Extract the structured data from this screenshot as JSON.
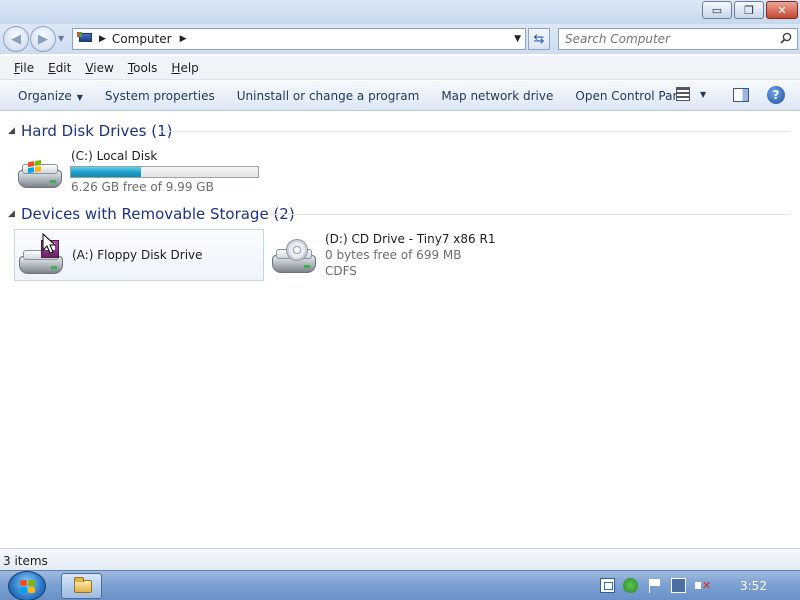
{
  "window": {
    "controls": {
      "minimize": "▭",
      "maximize": "❐",
      "close": "✕"
    }
  },
  "address": {
    "location": "Computer",
    "search_placeholder": "Search Computer"
  },
  "menu": [
    {
      "first": "F",
      "rest": "ile"
    },
    {
      "first": "E",
      "rest": "dit"
    },
    {
      "first": "V",
      "rest": "iew"
    },
    {
      "first": "T",
      "rest": "ools"
    },
    {
      "first": "H",
      "rest": "elp"
    }
  ],
  "commands": {
    "organize": "Organize",
    "system_properties": "System properties",
    "uninstall": "Uninstall or change a program",
    "map_drive": "Map network drive",
    "control_panel": "Open Control Panel",
    "help": "?"
  },
  "groups": {
    "hdd": {
      "title": "Hard Disk Drives (1)",
      "drives": [
        {
          "name": "(C:) Local Disk",
          "free": "6.26 GB free of 9.99 GB",
          "used_fraction": 0.373
        }
      ]
    },
    "removable": {
      "title": "Devices with Removable Storage (2)",
      "drives": [
        {
          "name": "(A:) Floppy Disk Drive"
        },
        {
          "name": "(D:) CD Drive - Tiny7 x86 R1",
          "free": "0 bytes free of 699 MB",
          "fs": "CDFS"
        }
      ]
    }
  },
  "status": {
    "items": "3 items"
  },
  "taskbar": {
    "clock": "3:52"
  },
  "colors": {
    "group_title": "#1e3287",
    "usage_fill": "#1b9dc6"
  }
}
